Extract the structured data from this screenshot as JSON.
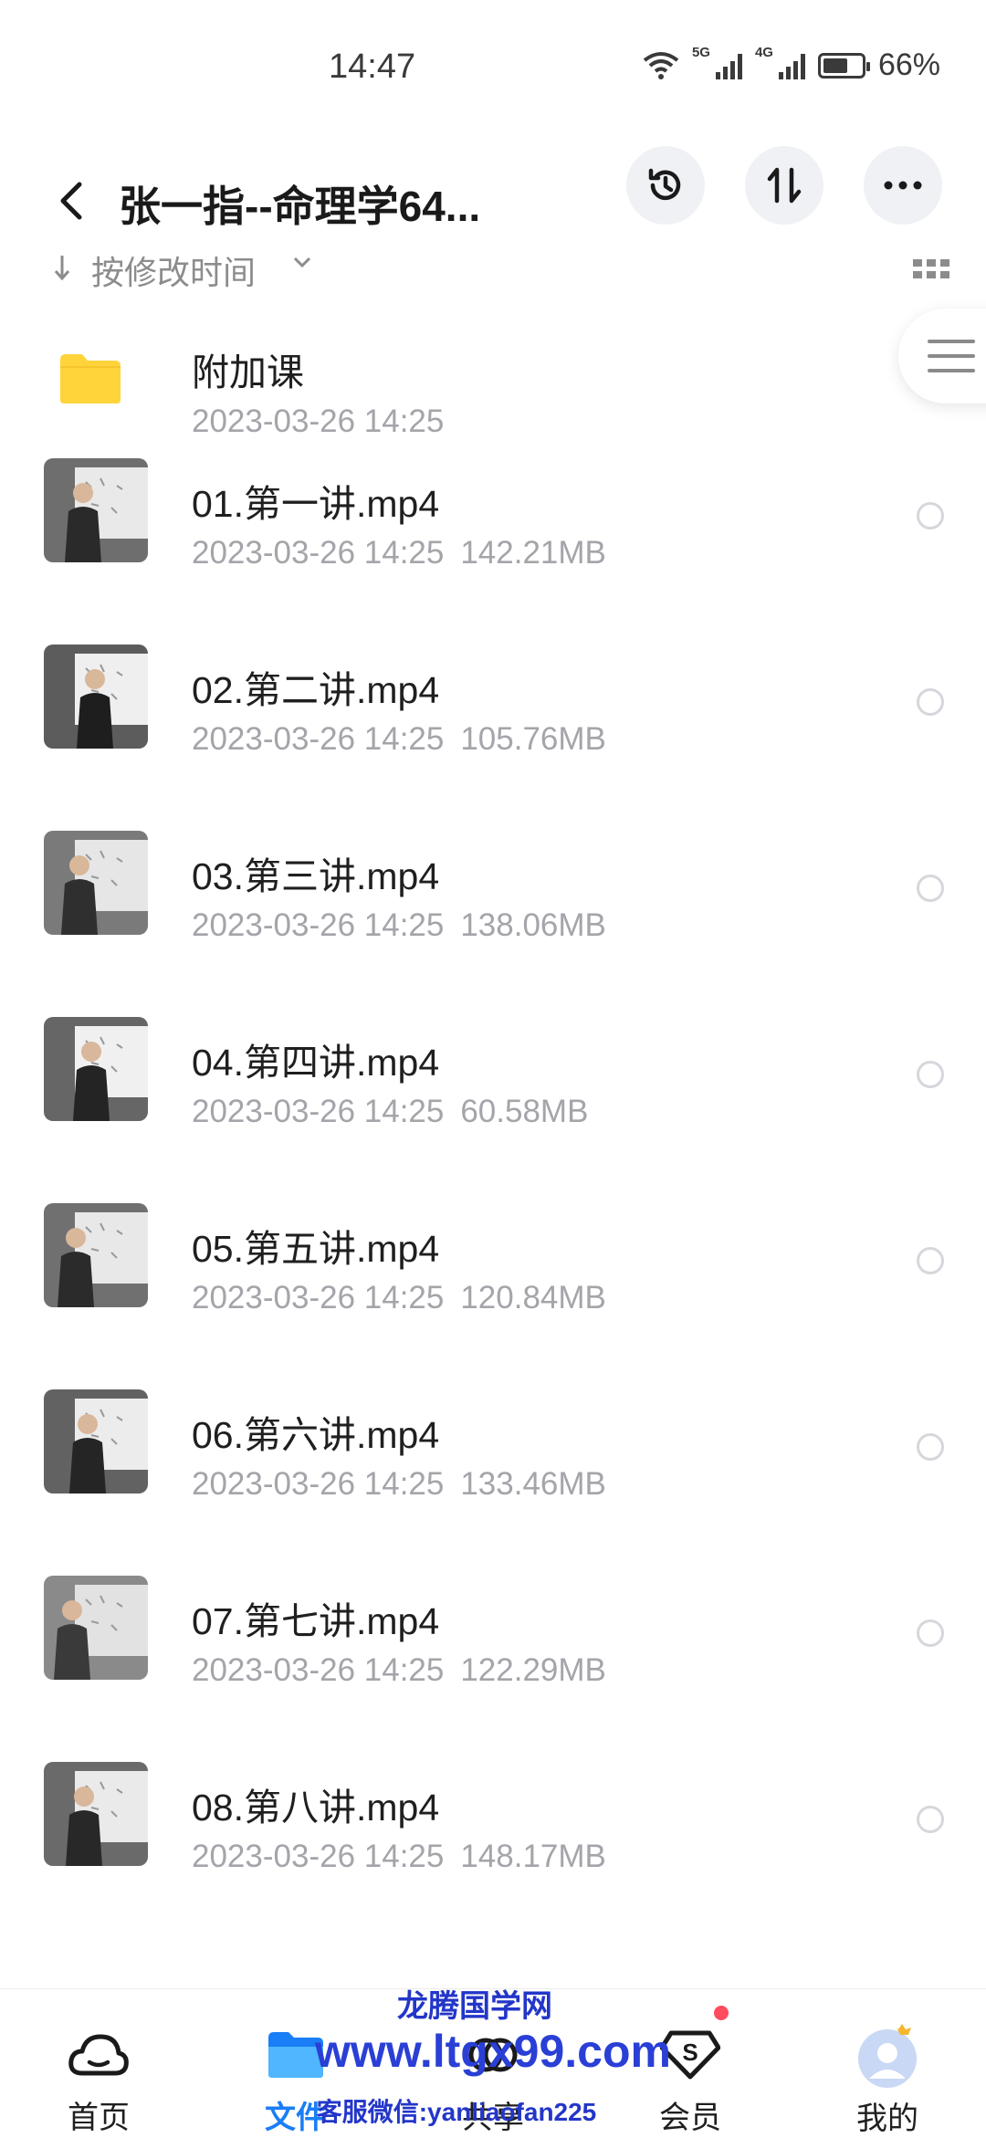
{
  "status_bar": {
    "time": "14:47",
    "network_1": "5G",
    "network_2": "4G",
    "battery": "66%",
    "battery_level": 0.66
  },
  "header": {
    "title": "张一指--命理学64..."
  },
  "sort": {
    "label": "按修改时间"
  },
  "files": [
    {
      "name": "附加课",
      "date": "2023-03-26  14:25",
      "size": "",
      "type": "folder"
    },
    {
      "name": "01.第一讲.mp4",
      "date": "2023-03-26  14:25",
      "size": "142.21MB",
      "type": "video"
    },
    {
      "name": "02.第二讲.mp4",
      "date": "2023-03-26  14:25",
      "size": "105.76MB",
      "type": "video"
    },
    {
      "name": "03.第三讲.mp4",
      "date": "2023-03-26  14:25",
      "size": "138.06MB",
      "type": "video"
    },
    {
      "name": "04.第四讲.mp4",
      "date": "2023-03-26  14:25",
      "size": "60.58MB",
      "type": "video"
    },
    {
      "name": "05.第五讲.mp4",
      "date": "2023-03-26  14:25",
      "size": "120.84MB",
      "type": "video"
    },
    {
      "name": "06.第六讲.mp4",
      "date": "2023-03-26  14:25",
      "size": "133.46MB",
      "type": "video"
    },
    {
      "name": "07.第七讲.mp4",
      "date": "2023-03-26  14:25",
      "size": "122.29MB",
      "type": "video"
    },
    {
      "name": "08.第八讲.mp4",
      "date": "2023-03-26  14:25",
      "size": "148.17MB",
      "type": "video"
    }
  ],
  "bottom_nav": [
    {
      "label": "首页",
      "icon": "cloud-home-icon",
      "active": false
    },
    {
      "label": "文件",
      "icon": "folder-icon",
      "active": true
    },
    {
      "label": "共享",
      "icon": "share-icon",
      "active": false
    },
    {
      "label": "会员",
      "icon": "vip-diamond-icon",
      "active": false
    },
    {
      "label": "我的",
      "icon": "avatar-icon",
      "active": false
    }
  ],
  "watermark": {
    "line1": "龙腾国学网",
    "line2": "www.ltgx99.com",
    "line3": "客服微信:yanliaofan225"
  },
  "colors": {
    "accent": "#1a7ef6",
    "folder": "#ffd43b",
    "meta_text": "#a4a4aa",
    "watermark": "#2336c9",
    "badge": "#ff4d5e"
  }
}
